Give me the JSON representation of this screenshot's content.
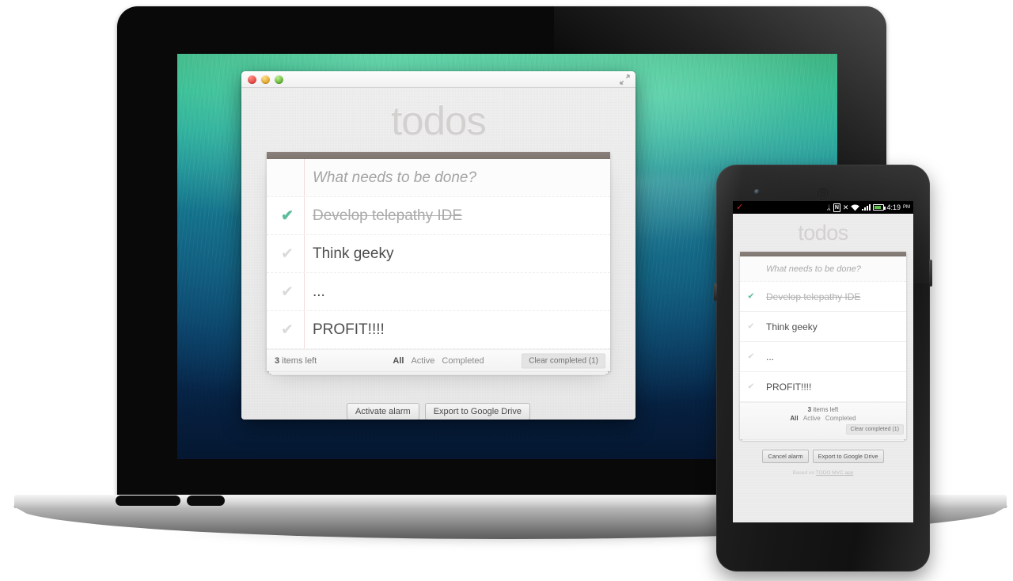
{
  "app": {
    "title": "todos",
    "new_todo_placeholder": "What needs to be done?",
    "todos": [
      {
        "label": "Develop telepathy IDE",
        "completed": true,
        "check": "✔"
      },
      {
        "label": "Think geeky",
        "completed": false,
        "check": "✔"
      },
      {
        "label": "...",
        "completed": false,
        "check": "✔"
      },
      {
        "label": "PROFIT!!!!",
        "completed": false,
        "check": "✔"
      }
    ],
    "footer": {
      "count_number": "3",
      "count_text": " items left",
      "filters": [
        {
          "label": "All",
          "selected": true
        },
        {
          "label": "Active",
          "selected": false
        },
        {
          "label": "Completed",
          "selected": false
        }
      ],
      "clear_completed": "Clear completed (1)"
    },
    "actions_desktop": {
      "alarm": "Activate alarm",
      "export": "Export to Google Drive"
    },
    "actions_phone": {
      "alarm": "Cancel alarm",
      "export": "Export to Google Drive"
    },
    "credit_prefix": "Based on ",
    "credit_link": "TODO MVC app"
  },
  "window": {
    "controls": {
      "close": "close",
      "minimize": "minimize",
      "zoom": "zoom"
    },
    "fullscreen_icon": "fullscreen-arrows"
  },
  "phone": {
    "status_bar": {
      "notification_icon": "✓",
      "icons": [
        "bluetooth-icon",
        "nfc-icon",
        "mute-icon",
        "wifi-icon",
        "signal-icon",
        "battery-icon"
      ],
      "bluetooth_glyph": "ᛦ",
      "nfc_glyph": "N",
      "mute_glyph": "✕",
      "wifi_glyph": "◠",
      "time": "4:19",
      "meridiem": "PM"
    }
  },
  "colors": {
    "accent_green": "#5dbd9a",
    "title_gray": "#d3d0d0",
    "card_topbar": "#7d746e",
    "battery_green": "#5cc24a",
    "notification_red": "#d03030"
  }
}
